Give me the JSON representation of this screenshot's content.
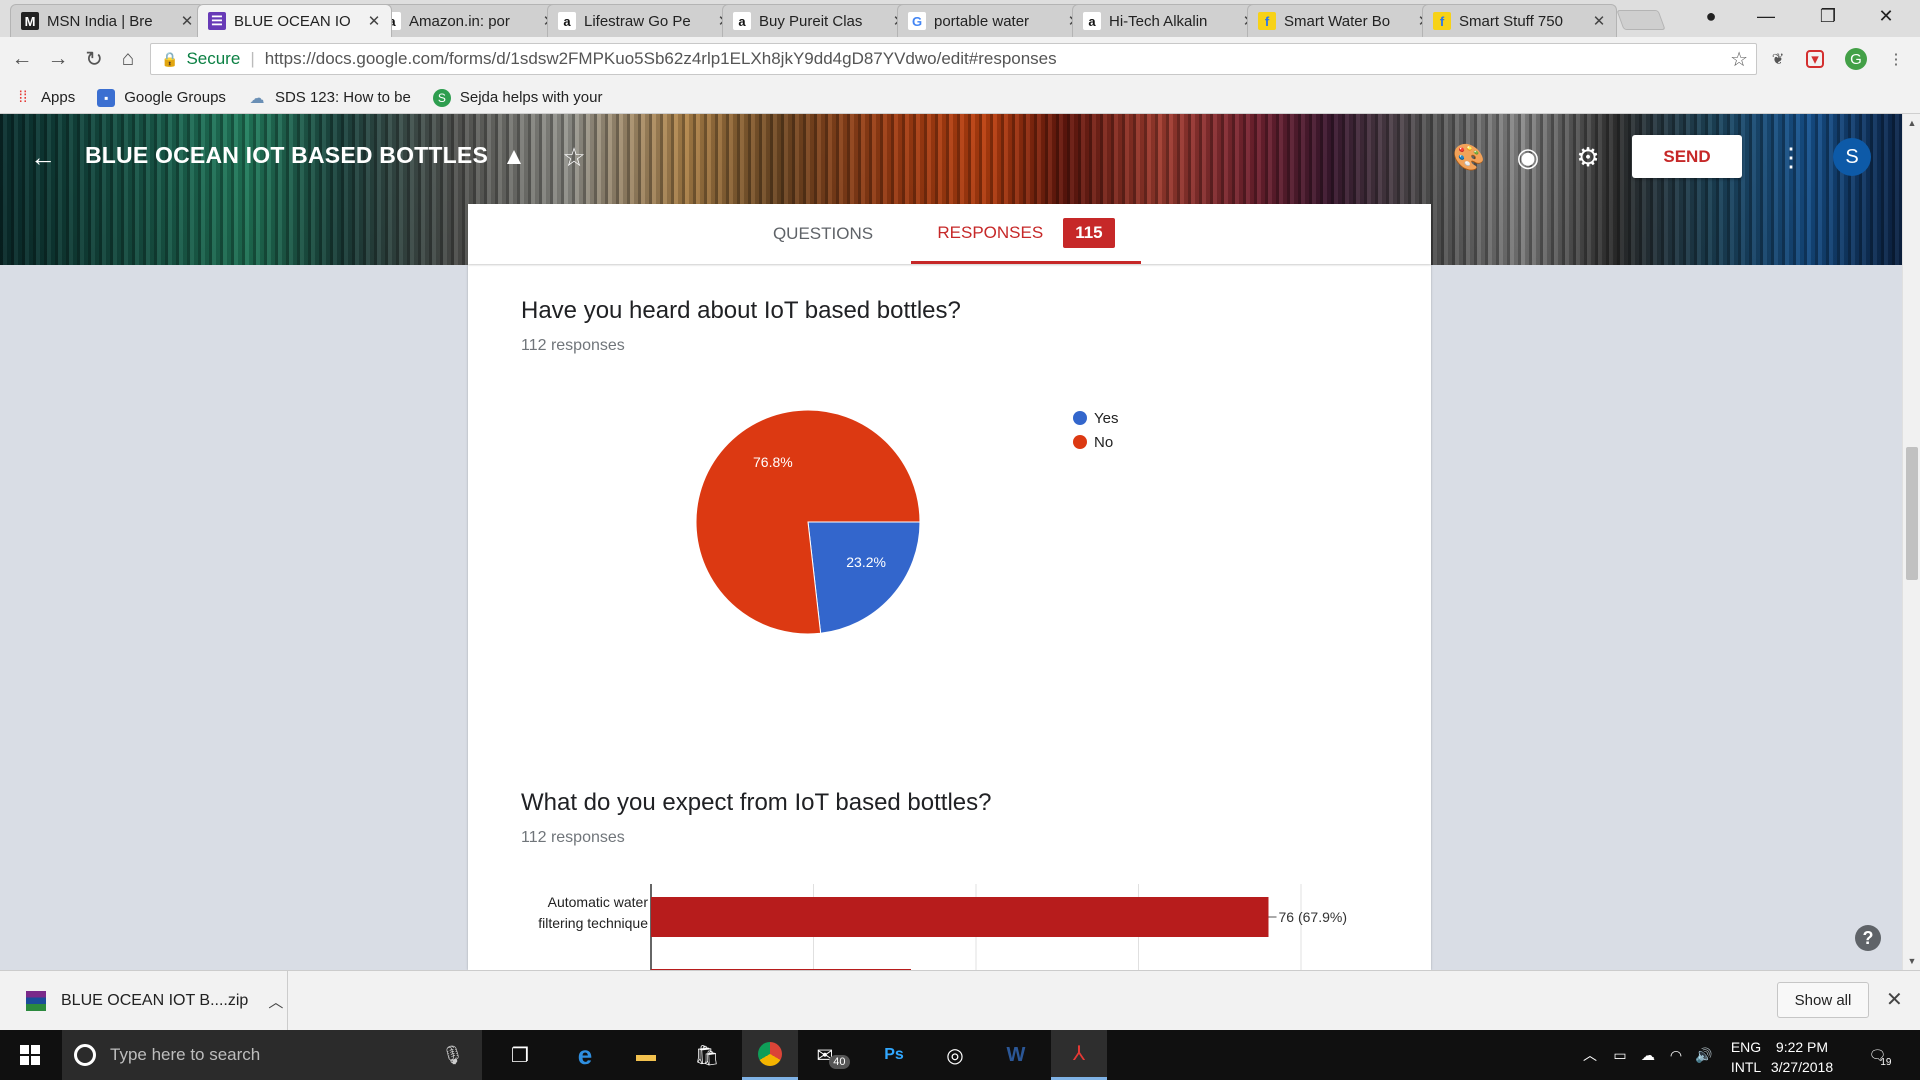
{
  "browser": {
    "tabs": [
      {
        "title": "MSN India | Bre",
        "favicon": "msn-icon",
        "favicon_char": "M",
        "favicon_bg": "#222222",
        "favicon_fg": "#ffffff"
      },
      {
        "title": "BLUE OCEAN IO",
        "favicon": "forms-icon",
        "favicon_char": "☰",
        "favicon_bg": "#673ab7",
        "favicon_fg": "#ffffff"
      },
      {
        "title": "Amazon.in: por",
        "favicon": "amazon-icon",
        "favicon_char": "a",
        "favicon_bg": "#ffffff",
        "favicon_fg": "#111111"
      },
      {
        "title": "Lifestraw Go Pe",
        "favicon": "amazon-icon",
        "favicon_char": "a",
        "favicon_bg": "#ffffff",
        "favicon_fg": "#111111"
      },
      {
        "title": "Buy Pureit Clas",
        "favicon": "amazon-icon",
        "favicon_char": "a",
        "favicon_bg": "#ffffff",
        "favicon_fg": "#111111"
      },
      {
        "title": "portable water",
        "favicon": "google-icon",
        "favicon_char": "G",
        "favicon_bg": "#ffffff",
        "favicon_fg": "#4285f4"
      },
      {
        "title": "Hi-Tech Alkalin",
        "favicon": "amazon-icon",
        "favicon_char": "a",
        "favicon_bg": "#ffffff",
        "favicon_fg": "#111111"
      },
      {
        "title": "Smart Water Bo",
        "favicon": "flipkart-icon",
        "favicon_char": "f",
        "favicon_bg": "#f7d217",
        "favicon_fg": "#2874f0"
      },
      {
        "title": "Smart Stuff 750",
        "favicon": "flipkart-icon",
        "favicon_char": "f",
        "favicon_bg": "#f7d217",
        "favicon_fg": "#2874f0"
      }
    ],
    "active_tab": 1,
    "omnibox": {
      "secure_label": "Secure",
      "url": "https://docs.google.com/forms/d/1sdsw2FMPKuo5Sb62z4rlp1ELXh8jkY9dd4gD87YVdwo/edit#responses"
    },
    "bookmarks": [
      {
        "label": "Apps",
        "icon": "apps-grid-icon"
      },
      {
        "label": "Google Groups",
        "icon": "google-groups-icon"
      },
      {
        "label": "SDS 123: How to be",
        "icon": "cloud-icon"
      },
      {
        "label": "Sejda helps with your",
        "icon": "sejda-icon"
      }
    ]
  },
  "form": {
    "title": "BLUE OCEAN IOT BASED BOTTLES",
    "send_label": "SEND",
    "avatar_initial": "S",
    "tabs": {
      "questions": "QUESTIONS",
      "responses": "RESPONSES",
      "responses_count": "115"
    },
    "accent_color": "#c62828"
  },
  "questions": [
    {
      "title": "Have you heard about IoT based bottles?",
      "responses": "112 responses"
    },
    {
      "title": "What do you expect from IoT based bottles?",
      "responses": "112 responses"
    }
  ],
  "chart_data": [
    {
      "type": "pie",
      "title": "Have you heard about IoT based bottles?",
      "legend_position": "right",
      "slices": [
        {
          "label": "Yes",
          "value": 23.2,
          "display": "23.2%",
          "color": "#3366cc"
        },
        {
          "label": "No",
          "value": 76.8,
          "display": "76.8%",
          "color": "#dc3912"
        }
      ]
    },
    {
      "type": "bar",
      "orientation": "horizontal",
      "title": "What do you expect from IoT based bottles?",
      "categories": [
        "Automatic water filtering technique"
      ],
      "category_lines": [
        [
          "Automatic water",
          "filtering technique"
        ]
      ],
      "values": [
        76
      ],
      "value_labels": [
        "76 (67.9%)"
      ],
      "xlim": [
        0,
        80
      ],
      "grid": true,
      "bar_color": "#b71c1c",
      "partial_next_bar_value": 32
    }
  ],
  "download_bar": {
    "file": "BLUE OCEAN IOT B....zip",
    "show_all": "Show all"
  },
  "taskbar": {
    "search_placeholder": "Type here to search",
    "mail_badge": "40",
    "lang_top": "ENG",
    "lang_bottom": "INTL",
    "time": "9:22 PM",
    "date": "3/27/2018",
    "notification_count": "19"
  }
}
